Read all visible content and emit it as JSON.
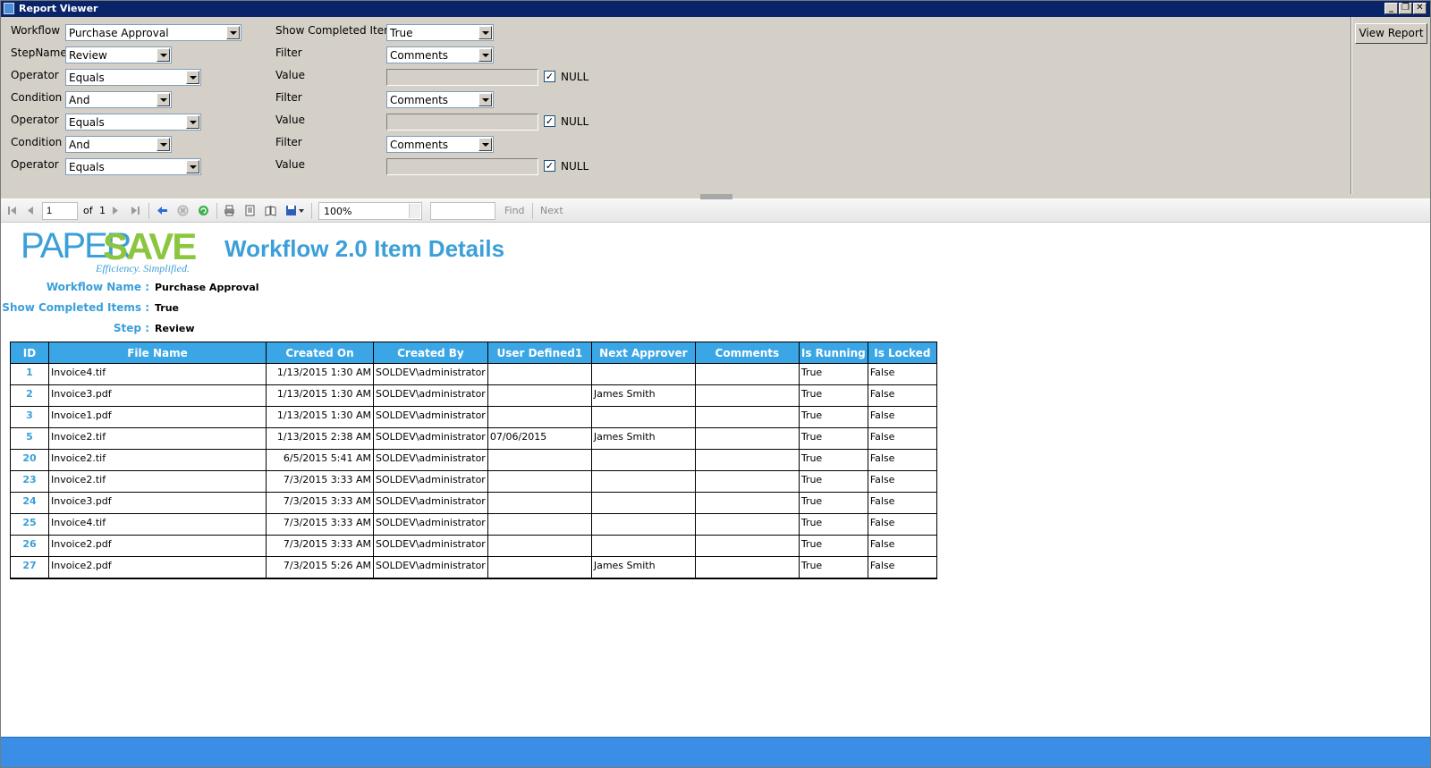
{
  "window": {
    "title": "Report Viewer"
  },
  "params": {
    "workflow_label": "Workflow",
    "workflow_value": "Purchase Approval",
    "stepname_label": "StepName",
    "stepname_value": "Review",
    "show_completed_label": "Show Completed Items",
    "show_completed_value": "True",
    "rows": [
      {
        "op_label": "Operator",
        "op_value": "Equals",
        "filter_label": "Filter",
        "filter_value": "Comments",
        "value_label": "Value",
        "null_label": "NULL",
        "null_checked": true
      },
      {
        "cond_label": "Condition",
        "cond_value": "And",
        "op_label": "Operator",
        "op_value": "Equals",
        "filter_label": "Filter",
        "filter_value": "Comments",
        "value_label": "Value",
        "null_label": "NULL",
        "null_checked": true
      },
      {
        "cond_label": "Condition",
        "cond_value": "And",
        "op_label": "Operator",
        "op_value": "Equals",
        "value_label": "Value",
        "null_label": "NULL",
        "null_checked": true
      }
    ],
    "view_report_label": "View Report"
  },
  "toolbar": {
    "page_value": "1",
    "of_label": "of",
    "total_pages": "1",
    "zoom_value": "100%",
    "find_label": "Find",
    "next_label": "Next"
  },
  "report": {
    "logo": {
      "paper": "PAPER",
      "save": "SAVE",
      "tagline": "Efficiency. Simplified."
    },
    "title": "Workflow 2.0 Item Details",
    "meta": [
      {
        "label": "Workflow Name :",
        "value": "Purchase Approval"
      },
      {
        "label": "Show Completed Items :",
        "value": "True"
      },
      {
        "label": "Step :",
        "value": "Review"
      }
    ],
    "columns": [
      "ID",
      "File Name",
      "Created On",
      "Created By",
      "User Defined1",
      "Next Approver",
      "Comments",
      "Is Running",
      "Is Locked"
    ],
    "rows": [
      [
        "1",
        "Invoice4.tif",
        "1/13/2015 1:30 AM",
        "SOLDEV\\administrator",
        "",
        "",
        "",
        "True",
        "False"
      ],
      [
        "2",
        "Invoice3.pdf",
        "1/13/2015 1:30 AM",
        "SOLDEV\\administrator",
        "",
        "James Smith",
        "",
        "True",
        "False"
      ],
      [
        "3",
        "Invoice1.pdf",
        "1/13/2015 1:30 AM",
        "SOLDEV\\administrator",
        "",
        "",
        "",
        "True",
        "False"
      ],
      [
        "5",
        "Invoice2.tif",
        "1/13/2015 2:38 AM",
        "SOLDEV\\administrator",
        "07/06/2015",
        "James Smith",
        "",
        "True",
        "False"
      ],
      [
        "20",
        "Invoice2.tif",
        "6/5/2015 5:41 AM",
        "SOLDEV\\administrator",
        "",
        "",
        "",
        "True",
        "False"
      ],
      [
        "23",
        "Invoice2.tif",
        "7/3/2015 3:33 AM",
        "SOLDEV\\administrator",
        "",
        "",
        "",
        "True",
        "False"
      ],
      [
        "24",
        "Invoice3.pdf",
        "7/3/2015 3:33 AM",
        "SOLDEV\\administrator",
        "",
        "",
        "",
        "True",
        "False"
      ],
      [
        "25",
        "Invoice4.tif",
        "7/3/2015 3:33 AM",
        "SOLDEV\\administrator",
        "",
        "",
        "",
        "True",
        "False"
      ],
      [
        "26",
        "Invoice2.pdf",
        "7/3/2015 3:33 AM",
        "SOLDEV\\administrator",
        "",
        "",
        "",
        "True",
        "False"
      ],
      [
        "27",
        "Invoice2.pdf",
        "7/3/2015 5:26 AM",
        "SOLDEV\\administrator",
        "",
        "James Smith",
        "",
        "True",
        "False"
      ]
    ]
  },
  "colors": {
    "accent": "#3aa6e6",
    "logo_blue": "#3b9fd8",
    "logo_green": "#8cc63f",
    "titlebar": "#0a246a",
    "statusbar": "#3a8ee6"
  }
}
